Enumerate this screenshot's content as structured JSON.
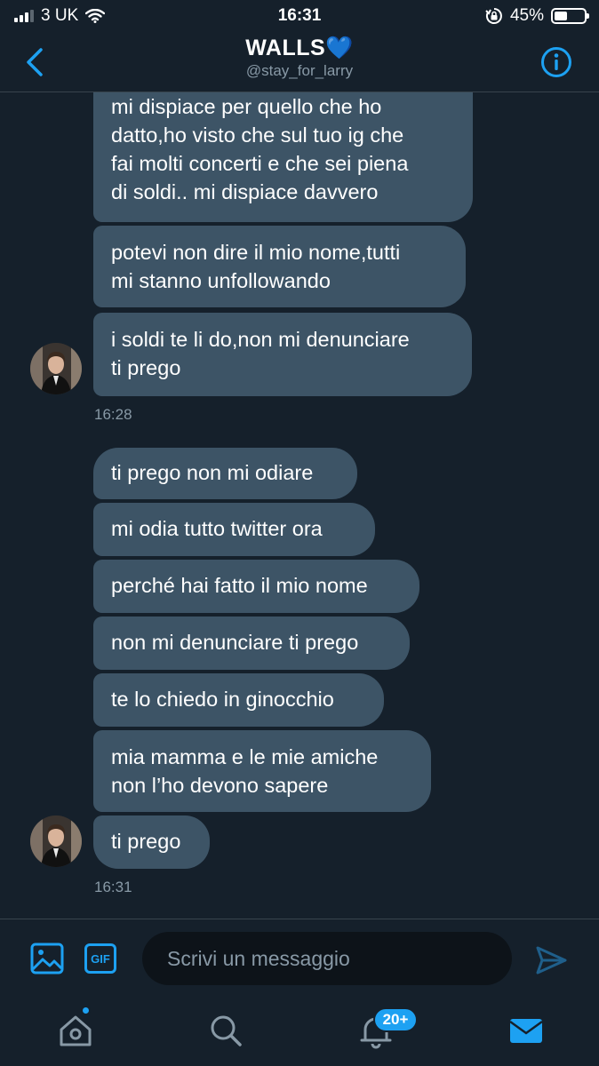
{
  "status_bar": {
    "carrier": "3 UK",
    "time": "16:31",
    "battery_percent": "45%",
    "battery_level": 0.45
  },
  "header": {
    "title": "WALLS💙",
    "handle": "@stay_for_larry"
  },
  "messages": [
    {
      "text": "mi dispiace per quello che ho\ndatto,ho visto che sul tuo ig che\nfai molti concerti e che sei piena\ndi soldi.. mi dispiace davvero"
    },
    {
      "text": "potevi non dire il mio nome,tutti\nmi stanno unfollowando"
    },
    {
      "text": "i soldi te li do,non mi denunciare\nti prego"
    },
    {
      "text": "ti prego non mi odiare"
    },
    {
      "text": "mi odia tutto twitter ora"
    },
    {
      "text": "perché hai fatto il mio nome"
    },
    {
      "text": "non mi denunciare ti prego"
    },
    {
      "text": "te lo chiedo in ginocchio"
    },
    {
      "text": "mia mamma e le mie amiche\nnon l’ho devono sapere"
    },
    {
      "text": "ti prego"
    }
  ],
  "timestamps": [
    "16:28",
    "16:31"
  ],
  "composer": {
    "gif_label": "GIF",
    "placeholder": "Scrivi un messaggio"
  },
  "tabbar": {
    "notifications_badge": "20+",
    "icons": [
      "home-icon",
      "search-icon",
      "bell-icon",
      "mail-icon"
    ]
  },
  "colors": {
    "background": "#15202b",
    "bubble": "#3d5466",
    "accent": "#1da1f2",
    "muted": "#8899a6"
  }
}
